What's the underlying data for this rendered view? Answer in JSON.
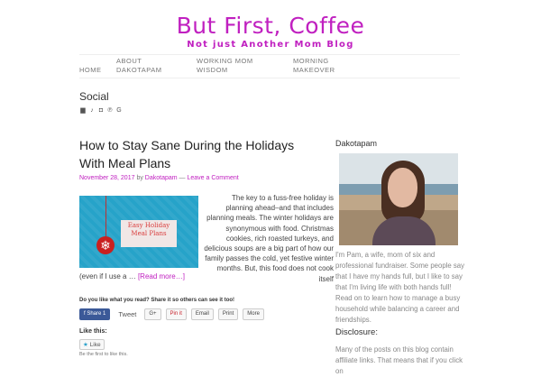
{
  "site": {
    "title": "But First, Coffee",
    "tagline": "Not just Another Mom Blog",
    "accent": "#c020c0"
  },
  "nav": {
    "items": [
      {
        "line1": "HOME",
        "line2": ""
      },
      {
        "line1": "ABOUT",
        "line2": "DAKOTAPAM"
      },
      {
        "line1": "WORKING MOM",
        "line2": "WISDOM"
      },
      {
        "line1": "MORNING",
        "line2": "MAKEOVER"
      }
    ]
  },
  "social": {
    "title": "Social",
    "icons": [
      "facebook-icon",
      "twitter-icon",
      "instagram-icon",
      "pinterest-icon",
      "google-plus-icon"
    ]
  },
  "post": {
    "title": "How to Stay Sane During the Holidays With Meal Plans",
    "date": "November 28, 2017",
    "by": "by",
    "author": "Dakotapam",
    "sep": "—",
    "comment_link": "Leave a Comment",
    "image_caption": "Easy Holiday Meal Plans",
    "excerpt_lines": [
      "The key to a fuss-free holiday is",
      "planning ahead–and that includes",
      "planning meals. The winter holidays are",
      "synonymous with food. Christmas",
      "cookies, rich roasted turkeys, and",
      "delicious soups are a big part of how our",
      "family passes the cold, yet festive winter",
      "months. But, this food does not cook itself"
    ],
    "excerpt_last": "(even if I use a …",
    "read_more": "[Read more…]"
  },
  "share": {
    "prompt": "Do you like what you read? Share it so others can see it too!",
    "buttons": {
      "facebook": "f Share 1",
      "tweet": "Tweet",
      "gplus": "G+",
      "pinit": "Pin it",
      "email": "Email",
      "print": "Print",
      "more": "More"
    }
  },
  "likes": {
    "label": "Like this:",
    "button": "Like",
    "note": "Be the first to like this."
  },
  "sidebar": {
    "title": "Dakotapam",
    "bio": "I'm Pam, a wife, mom of six and professional fundraiser. Some people say that I have my hands full, but I like to say that I'm living life with both hands full! Read on to learn how to manage a busy household while balancing a career and friendships.",
    "disclosure_title": "Disclosure:",
    "disclosure_text": "Many of the posts on this blog contain affiliate links. That means that if you click on"
  }
}
